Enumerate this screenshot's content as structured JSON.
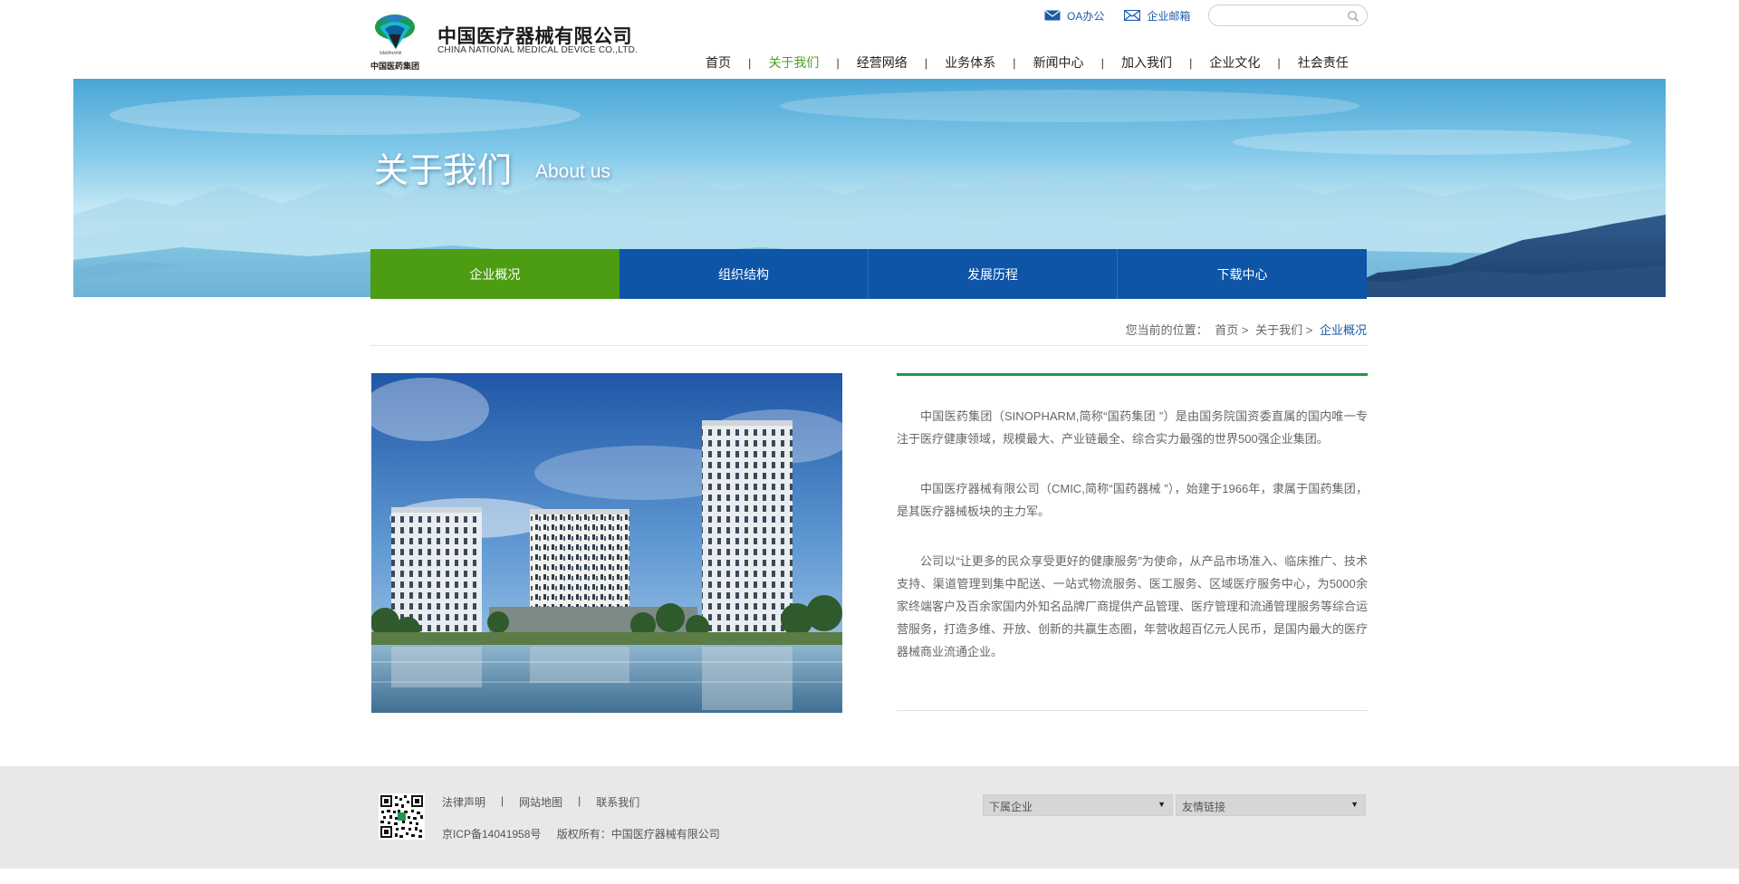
{
  "header": {
    "logo_cn": "中国医疗器械有限公司",
    "logo_en": "CHINA NATIONAL MEDICAL DEVICE CO.,LTD.",
    "logo_group": "中国医药集团",
    "top_links": [
      {
        "label": "OA办公",
        "icon": "mail-icon"
      },
      {
        "label": "企业邮箱",
        "icon": "envelope-icon"
      }
    ],
    "search_placeholder": ""
  },
  "nav": {
    "items": [
      "首页",
      "关于我们",
      "经营网络",
      "业务体系",
      "新闻中心",
      "加入我们",
      "企业文化",
      "社会责任"
    ],
    "active": "关于我们",
    "separator": "|"
  },
  "banner": {
    "title": "关于我们",
    "subtitle": "About us"
  },
  "subnav": {
    "tabs": [
      "企业概况",
      "组织结构",
      "发展历程",
      "下载中心"
    ],
    "active": "企业概况"
  },
  "breadcrumb": {
    "prefix": "您当前的位置：",
    "items": [
      "首页 >",
      "关于我们 >"
    ],
    "current": "企业概况"
  },
  "content": {
    "paragraphs": [
      "中国医药集团（SINOPHARM,简称“国药集团 ”）是由国务院国资委直属的国内唯一专注于医疗健康领域，规模最大、产业链最全、综合实力最强的世界500强企业集团。",
      "中国医疗器械有限公司（CMIC,简称“国药器械 ”），始建于1966年，隶属于国药集团，是其医疗器械板块的主力军。",
      "公司以“让更多的民众享受更好的健康服务”为使命，从产品市场准入、临床推广、技术支持、渠道管理到集中配送、一站式物流服务、医工服务、区域医疗服务中心，为5000余家终端客户及百余家国内外知名品牌厂商提供产品管理、医疗管理和流通管理服务等综合运营服务，打造多维、开放、创新的共赢生态圈，年营收超百亿元人民币，是国内最大的医疗器械商业流通企业。"
    ]
  },
  "footer": {
    "links": [
      "法律声明",
      "网站地图",
      "联系我们"
    ],
    "separator": "|",
    "icp": "京ICP备14041958号",
    "copyright": "版权所有：中国医疗器械有限公司",
    "select1": "下属企业",
    "select2": "友情链接",
    "arrow": "▼"
  },
  "colors": {
    "brand_blue": "#0e55a7",
    "active_green": "#4c9d12",
    "nav_active": "#4aa11f",
    "link_blue": "#1e5aa8",
    "rule_green": "#1a9a4a"
  }
}
